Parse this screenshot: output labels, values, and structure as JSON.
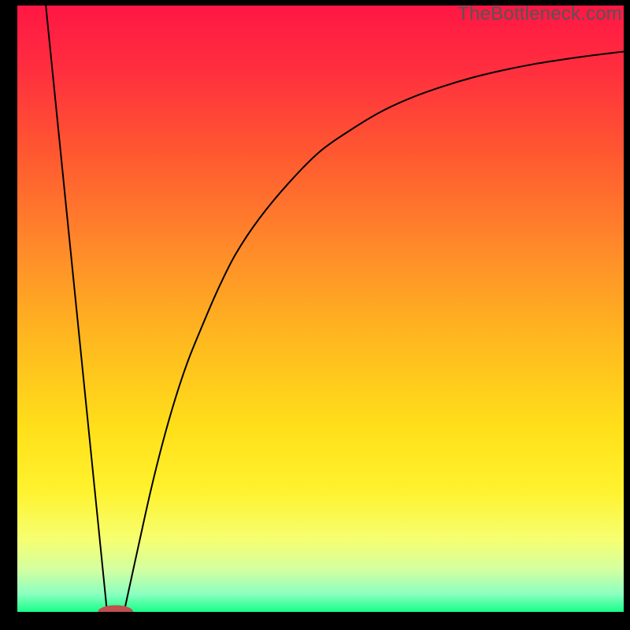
{
  "watermark": "TheBottleneck.com",
  "colors": {
    "gradient_stops": [
      {
        "offset": 0.0,
        "color": "#ff1744"
      },
      {
        "offset": 0.1,
        "color": "#ff2d3f"
      },
      {
        "offset": 0.25,
        "color": "#ff5a30"
      },
      {
        "offset": 0.4,
        "color": "#ff8a2a"
      },
      {
        "offset": 0.55,
        "color": "#ffb81f"
      },
      {
        "offset": 0.7,
        "color": "#ffe01a"
      },
      {
        "offset": 0.8,
        "color": "#fff22e"
      },
      {
        "offset": 0.88,
        "color": "#f6ff70"
      },
      {
        "offset": 0.93,
        "color": "#d4ffa0"
      },
      {
        "offset": 0.97,
        "color": "#8cffc0"
      },
      {
        "offset": 1.0,
        "color": "#18ff8a"
      }
    ],
    "curve": "#000000",
    "marker_fill": "#c0504d",
    "marker_stroke": "#c0504d",
    "frame": "#000000"
  },
  "chart_data": {
    "type": "line",
    "title": "",
    "xlabel": "",
    "ylabel": "",
    "xlim": [
      0,
      100
    ],
    "ylim": [
      0,
      100
    ],
    "series": [
      {
        "name": "left-branch",
        "x": [
          4.7,
          14.8
        ],
        "y": [
          100,
          0
        ]
      },
      {
        "name": "right-branch",
        "x": [
          17.6,
          20,
          22,
          24,
          26,
          28,
          30,
          33,
          36,
          40,
          45,
          50,
          55,
          60,
          65,
          70,
          75,
          80,
          85,
          90,
          95,
          100
        ],
        "y": [
          0,
          11,
          20,
          28,
          35,
          41,
          46,
          53,
          59,
          65,
          71,
          76,
          79.5,
          82.5,
          84.8,
          86.6,
          88.1,
          89.3,
          90.3,
          91.1,
          91.8,
          92.4
        ]
      }
    ],
    "marker": {
      "x_center": 16.2,
      "y_center": 0,
      "rx": 2.8,
      "ry": 1.0
    }
  }
}
